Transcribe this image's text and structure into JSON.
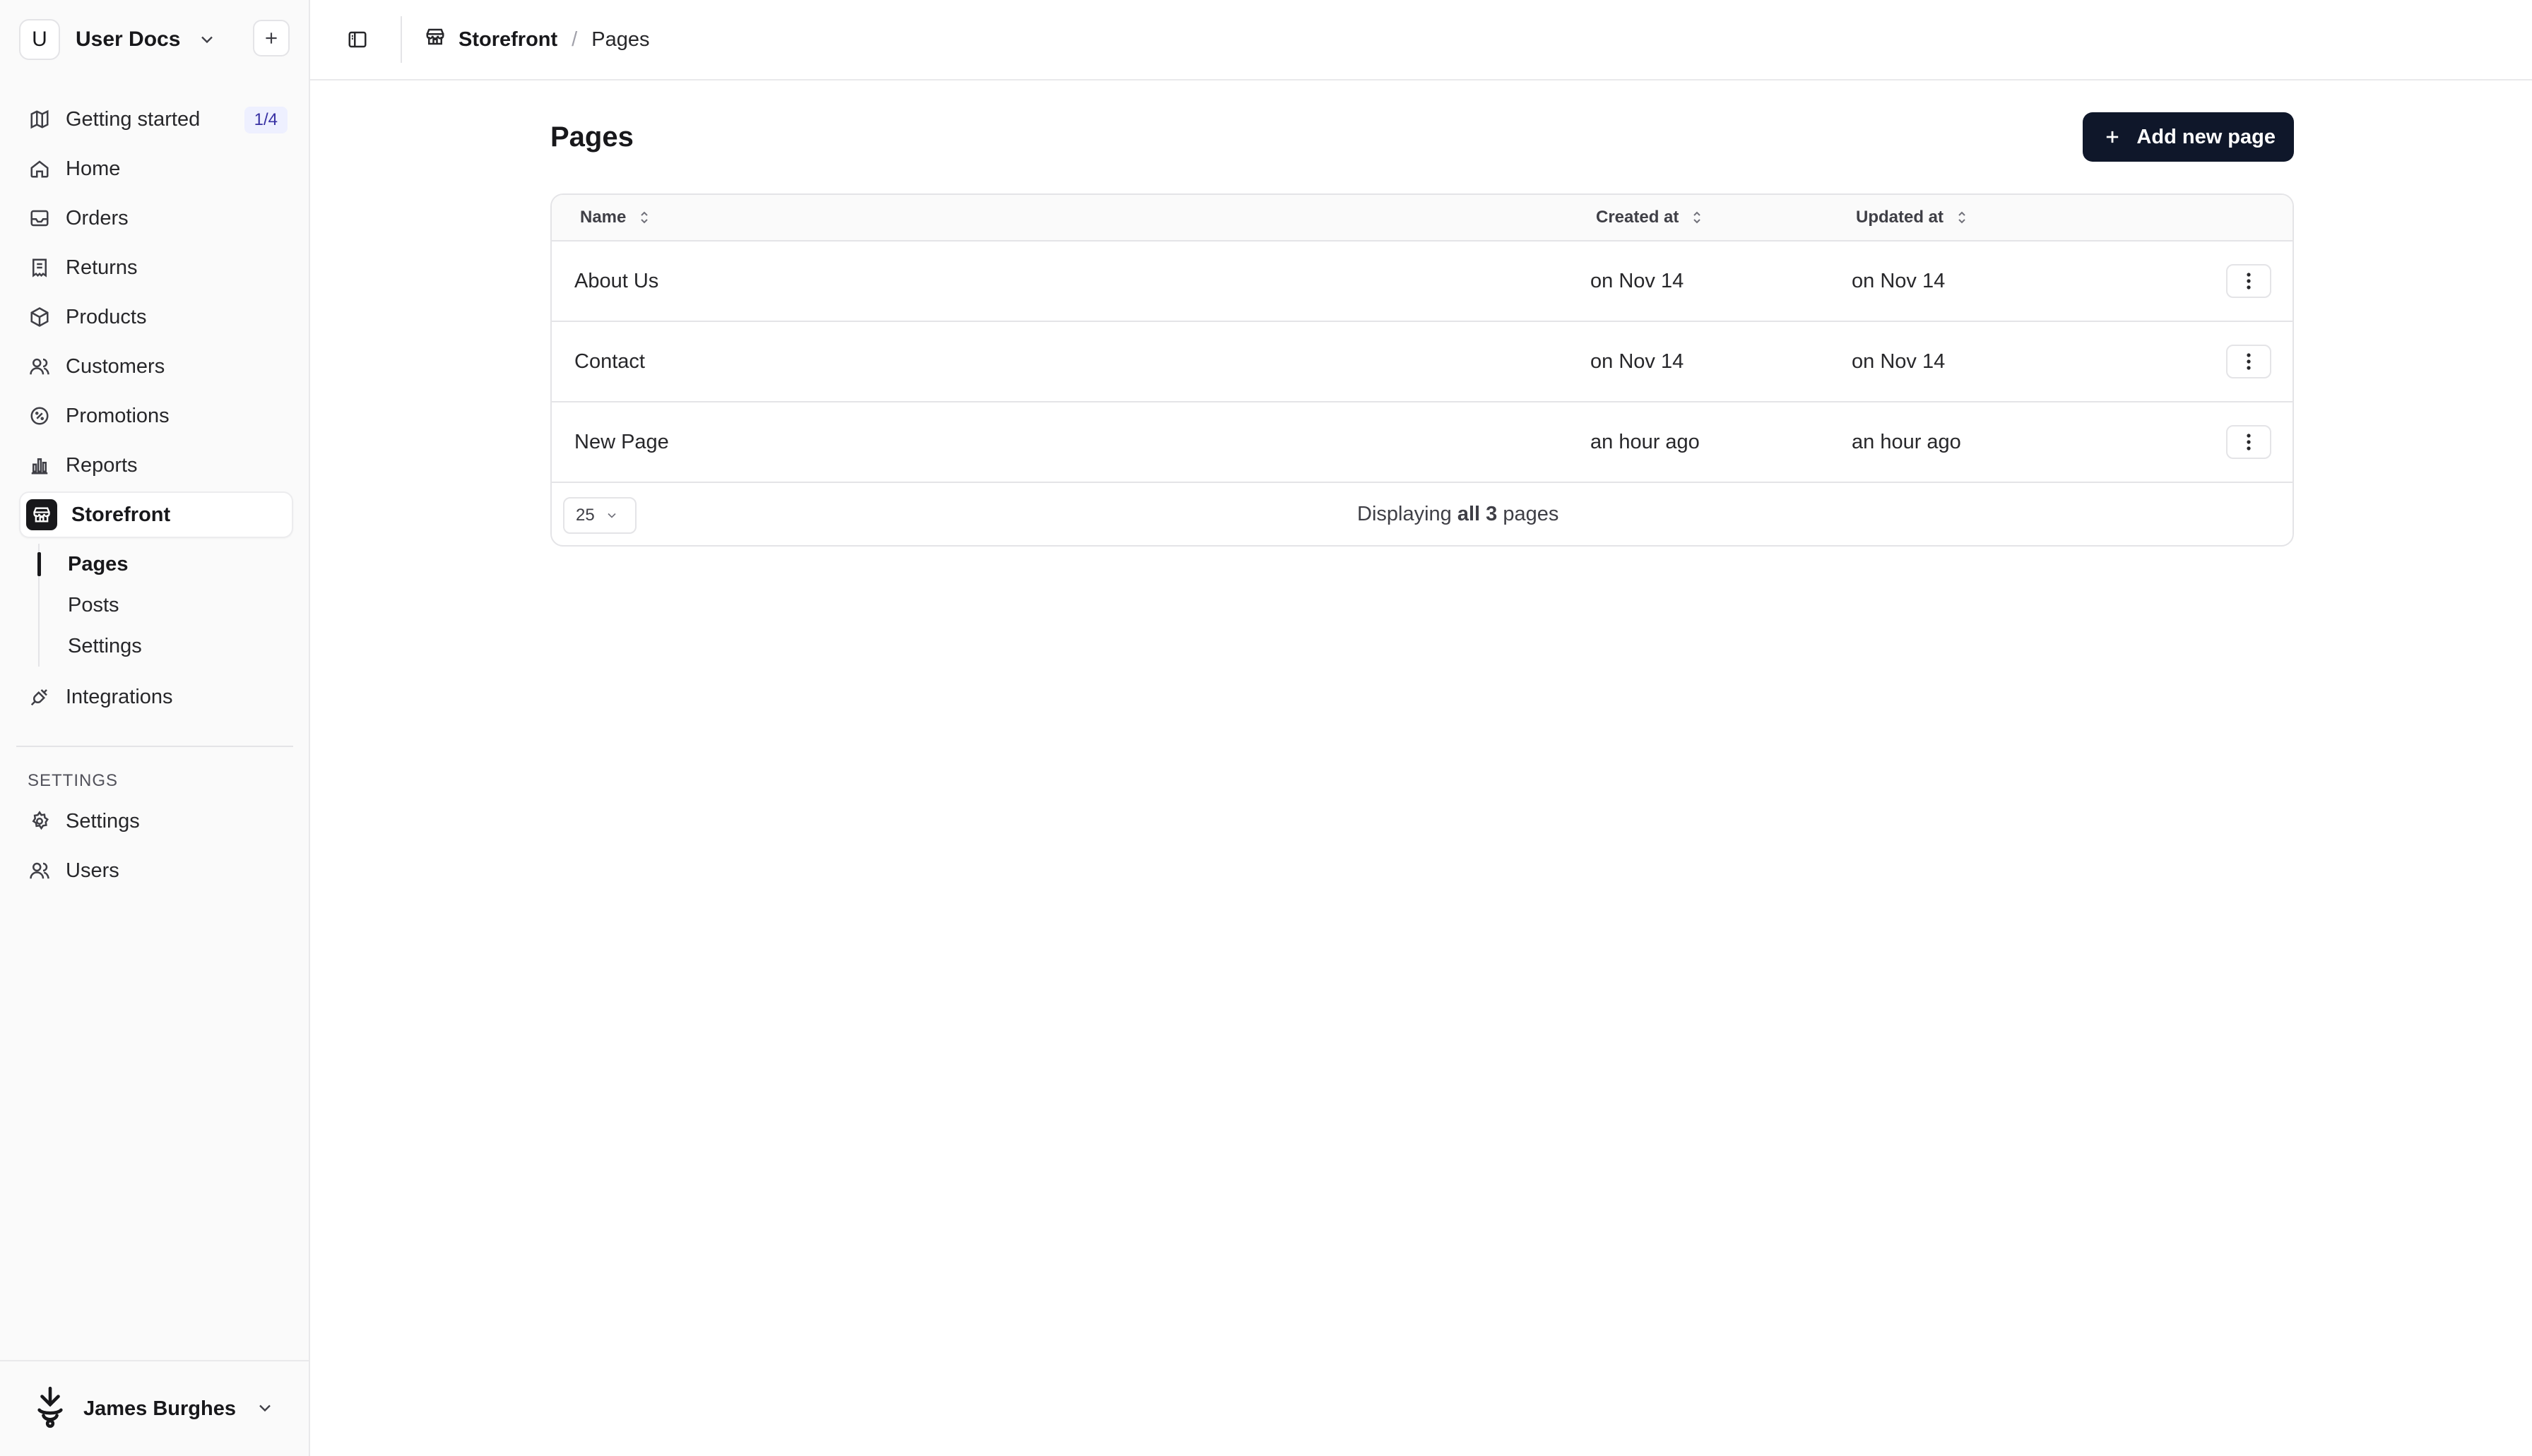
{
  "workspace": {
    "initial": "U",
    "name": "User Docs"
  },
  "nav": [
    {
      "key": "getting-started",
      "label": "Getting started",
      "icon": "map-icon",
      "badge": "1/4"
    },
    {
      "key": "home",
      "label": "Home",
      "icon": "home-icon"
    },
    {
      "key": "orders",
      "label": "Orders",
      "icon": "inbox-icon"
    },
    {
      "key": "returns",
      "label": "Returns",
      "icon": "receipt-icon"
    },
    {
      "key": "products",
      "label": "Products",
      "icon": "package-icon"
    },
    {
      "key": "customers",
      "label": "Customers",
      "icon": "users-icon"
    },
    {
      "key": "promotions",
      "label": "Promotions",
      "icon": "percent-icon"
    },
    {
      "key": "reports",
      "label": "Reports",
      "icon": "bar-chart-icon"
    },
    {
      "key": "storefront",
      "label": "Storefront",
      "icon": "store-icon",
      "active": true
    }
  ],
  "storefront_sub": [
    {
      "label": "Pages",
      "active": true
    },
    {
      "label": "Posts"
    },
    {
      "label": "Settings"
    }
  ],
  "integrations": {
    "label": "Integrations",
    "icon": "plug-icon"
  },
  "settings_section": {
    "title": "SETTINGS",
    "items": [
      {
        "label": "Settings",
        "icon": "gear-icon"
      },
      {
        "label": "Users",
        "icon": "users-icon"
      }
    ]
  },
  "user": {
    "name": "James Burghes"
  },
  "breadcrumb": {
    "section": "Storefront",
    "page": "Pages",
    "separator": "/"
  },
  "page": {
    "title": "Pages",
    "add_label": "Add new page"
  },
  "table": {
    "columns": {
      "name": "Name",
      "created": "Created at",
      "updated": "Updated at"
    },
    "rows": [
      {
        "name": "About Us",
        "created": "on Nov 14",
        "updated": "on Nov 14"
      },
      {
        "name": "Contact",
        "created": "on Nov 14",
        "updated": "on Nov 14"
      },
      {
        "name": "New Page",
        "created": "an hour ago",
        "updated": "an hour ago"
      }
    ],
    "per_page": "25",
    "footer": {
      "prefix": "Displaying",
      "strong": "all 3",
      "suffix": "pages"
    }
  },
  "colors": {
    "primary": "#0f172a",
    "border": "#e4e4e7",
    "sidebar_bg": "#fafafa",
    "badge_bg": "#eef0ff",
    "badge_text": "#3730a3"
  }
}
